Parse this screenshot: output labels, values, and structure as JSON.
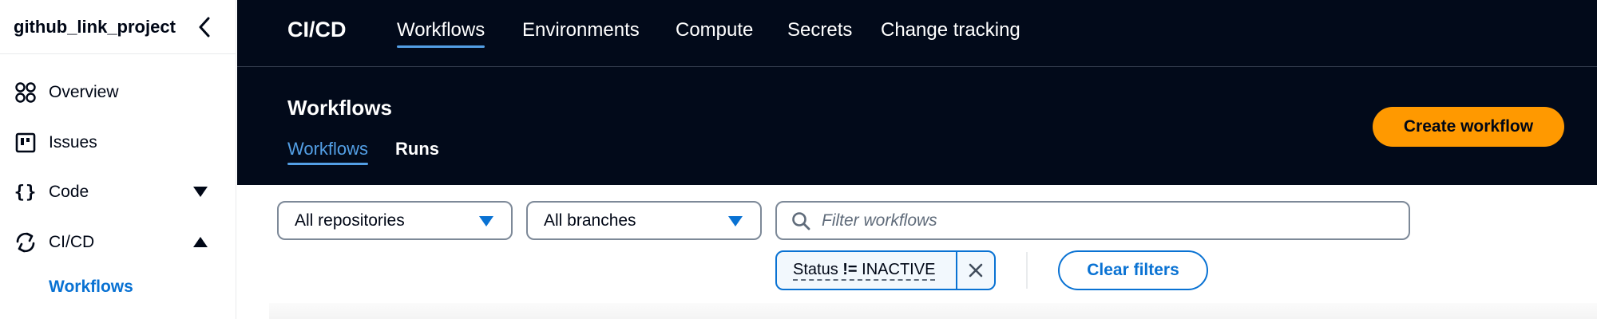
{
  "sidebar": {
    "project_name": "github_link_project",
    "items": [
      {
        "label": "Overview",
        "icon": "grid-icon"
      },
      {
        "label": "Issues",
        "icon": "board-icon"
      },
      {
        "label": "Code",
        "icon": "braces-icon"
      },
      {
        "label": "CI/CD",
        "icon": "sync-icon"
      }
    ],
    "sub_items": [
      {
        "label": "Workflows",
        "active": true
      }
    ]
  },
  "topnav": {
    "app_title": "CI/CD",
    "tabs": [
      {
        "label": "Workflows",
        "active": true
      },
      {
        "label": "Environments",
        "active": false
      },
      {
        "label": "Compute",
        "active": false
      },
      {
        "label": "Secrets",
        "active": false
      },
      {
        "label": "Change tracking",
        "active": false
      }
    ]
  },
  "page": {
    "title": "Workflows",
    "tabs": [
      {
        "label": "Workflows",
        "active": true
      },
      {
        "label": "Runs",
        "active": false
      }
    ],
    "create_button": "Create workflow"
  },
  "filters": {
    "repository_select": "All repositories",
    "branch_select": "All branches",
    "search_placeholder": "Filter workflows",
    "token": {
      "property": "Status",
      "operator": "!=",
      "value": "INACTIVE"
    },
    "clear_button": "Clear filters"
  },
  "colors": {
    "header_bg": "#020a1a",
    "accent_blue": "#0972d3",
    "active_tab_blue": "#539fe5",
    "primary_button": "#ff9900"
  }
}
